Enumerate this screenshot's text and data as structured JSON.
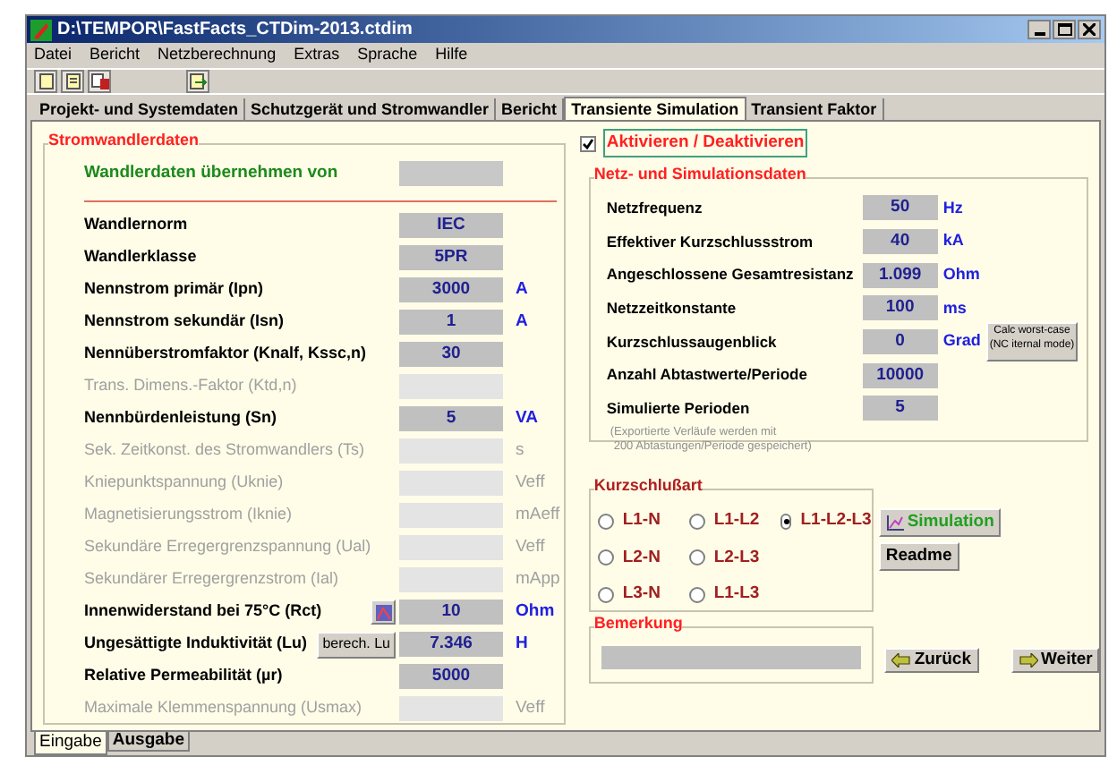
{
  "window": {
    "title": "D:\\TEMPOR\\FastFacts_CTDim-2013.ctdim"
  },
  "menu": [
    "Datei",
    "Bericht",
    "Netzberechnung",
    "Extras",
    "Sprache",
    "Hilfe"
  ],
  "tabs": [
    {
      "label": "Projekt- und Systemdaten",
      "selected": false
    },
    {
      "label": "Schutzgerät und Stromwandler",
      "selected": false
    },
    {
      "label": "Bericht",
      "selected": false
    },
    {
      "label": "Transiente Simulation",
      "selected": true
    },
    {
      "label": "Transient Faktor",
      "selected": false
    }
  ],
  "transformer": {
    "title": "Stromwandlerdaten",
    "source_label": "Wandlerdaten übernehmen von",
    "rows": [
      {
        "label": "Wandlernorm",
        "value": "IEC",
        "disabled": false
      },
      {
        "label": "Wandlerklasse",
        "value": "5PR",
        "disabled": false
      },
      {
        "label": "Nennstrom primär (Ipn)",
        "value": "3000",
        "unit": "A",
        "disabled": false
      },
      {
        "label": "Nennstrom sekundär (Isn)",
        "value": "1",
        "unit": "A",
        "disabled": false
      },
      {
        "label": "Nennüberstromfaktor (Knalf, Kssc,n)",
        "value": "30",
        "disabled": false
      },
      {
        "label": "Trans. Dimens.-Faktor (Ktd,n)",
        "disabled": true
      },
      {
        "label": "Nennbürdenleistung (Sn)",
        "value": "5",
        "unit": "VA",
        "disabled": false
      },
      {
        "label": "Sek. Zeitkonst. des Stromwandlers (Ts)",
        "unit": "s",
        "disabled": true
      },
      {
        "label": "Kniepunktspannung (Uknie)",
        "unit": "Veff",
        "disabled": true
      },
      {
        "label": "Magnetisierungsstrom (Iknie)",
        "unit": "mAeff",
        "disabled": true
      },
      {
        "label": "Sekundäre Erregergrenzspannung (Ual)",
        "unit": "Veff",
        "disabled": true
      },
      {
        "label": "Sekundärer Erregergrenzstrom (Ial)",
        "unit": "mApp",
        "disabled": true
      },
      {
        "label": "Innenwiderstand bei 75°C (Rct)",
        "value": "10",
        "unit": "Ohm",
        "disabled": false,
        "button": {
          "kind": "icon"
        }
      },
      {
        "label": "Ungesättigte Induktivität (Lu)",
        "value": "7.346",
        "unit": "H",
        "disabled": false,
        "button": {
          "kind": "text",
          "label": "berech. Lu"
        }
      },
      {
        "label": "Relative Permeabilität (µr)",
        "value": "5000",
        "disabled": false
      },
      {
        "label": "Maximale Klemmenspannung (Usmax)",
        "unit": "Veff",
        "disabled": true
      }
    ]
  },
  "activate": {
    "label": "Aktivieren / Deaktivieren",
    "checked": true
  },
  "network": {
    "title": "Netz- und Simulationsdaten",
    "rows": [
      {
        "label": "Netzfrequenz",
        "value": "50",
        "unit": "Hz"
      },
      {
        "label": "Effektiver Kurzschlussstrom",
        "value": "40",
        "unit": "kA"
      },
      {
        "label": "Angeschlossene Gesamtresistanz",
        "value": "1.099",
        "unit": "Ohm"
      },
      {
        "label": "Netzzeitkonstante",
        "value": "100",
        "unit": "ms"
      },
      {
        "label": "Kurzschlussaugenblick",
        "value": "0",
        "unit": "Grad",
        "button": [
          "Calc worst-case",
          "(NC iternal mode)"
        ]
      },
      {
        "label": "Anzahl Abtastwerte/Periode",
        "value": "10000"
      },
      {
        "label": "Simulierte Perioden",
        "value": "5"
      }
    ],
    "note": [
      "(Exportierte Verläufe werden mit",
      "200 Abtastungen/Periode gespeichert)"
    ]
  },
  "fault": {
    "title": "Kurzschlußart",
    "option_rows": [
      [
        {
          "label": "L1-N",
          "selected": false
        },
        {
          "label": "L1-L2",
          "selected": false
        },
        {
          "label": "L1-L2-L3",
          "selected": true
        }
      ],
      [
        {
          "label": "L2-N",
          "selected": false
        },
        {
          "label": "L2-L3",
          "selected": false
        }
      ],
      [
        {
          "label": "L3-N",
          "selected": false
        },
        {
          "label": "L1-L3",
          "selected": false
        }
      ]
    ]
  },
  "simulation_button": "Simulation",
  "readme_button": "Readme",
  "remark": {
    "title": "Bemerkung"
  },
  "back_button": "Zurück",
  "next_button": "Weiter",
  "bottom_tabs": [
    {
      "label": "Eingabe",
      "selected": true
    },
    {
      "label": "Ausgabe",
      "selected": false
    }
  ]
}
